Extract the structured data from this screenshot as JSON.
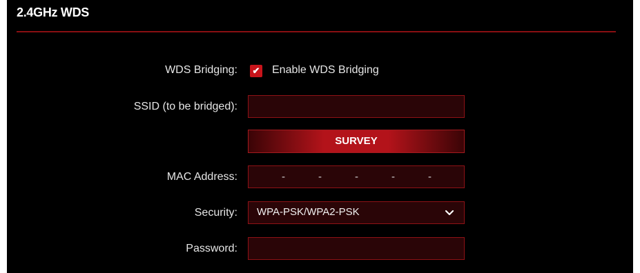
{
  "section": {
    "title": "2.4GHz WDS"
  },
  "wds_bridging": {
    "label": "WDS Bridging:",
    "checked": true,
    "checkbox_label": "Enable WDS Bridging"
  },
  "ssid": {
    "label": "SSID (to be bridged):",
    "value": ""
  },
  "survey": {
    "label": "SURVEY"
  },
  "mac": {
    "label": "MAC Address:",
    "separators": [
      "-",
      "-",
      "-",
      "-",
      "-"
    ]
  },
  "security": {
    "label": "Security:",
    "selected": "WPA-PSK/WPA2-PSK",
    "icon": "chevron-down-icon"
  },
  "password": {
    "label": "Password:",
    "value": ""
  },
  "colors": {
    "background": "#000000",
    "accent": "#c8141b",
    "field_border": "#8f1216",
    "field_fill": "#2a0507",
    "text": "#e6e6e6"
  }
}
